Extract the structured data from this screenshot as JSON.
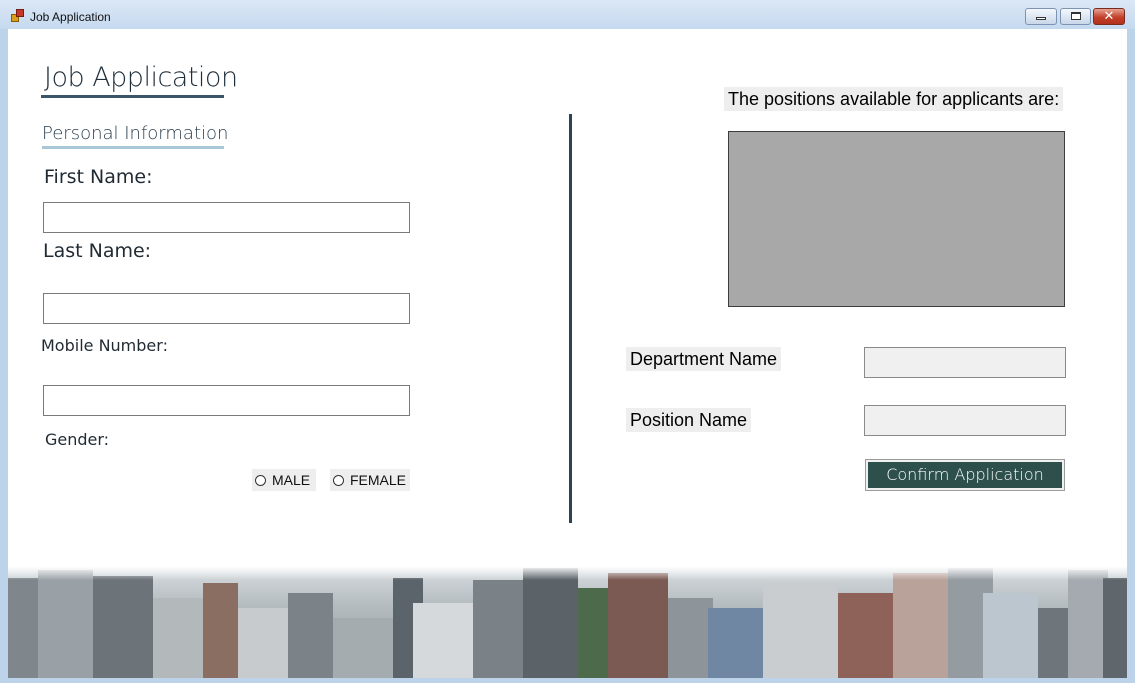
{
  "window": {
    "title": "Job Application",
    "controls": {
      "minimize": "minimize-icon",
      "maximize": "maximize-icon",
      "close": "close-icon"
    }
  },
  "form": {
    "heading": "Job Application",
    "section_title": "Personal Information",
    "first_name_label": "First Name:",
    "first_name_value": "",
    "last_name_label": "Last Name:",
    "last_name_value": "",
    "mobile_label": "Mobile Number:",
    "mobile_value": "",
    "gender_label": "Gender:",
    "gender_options": [
      "MALE",
      "FEMALE"
    ]
  },
  "positions": {
    "caption": "The positions available for applicants are:",
    "department_label": "Department Name",
    "department_value": "",
    "position_label": "Position Name",
    "position_value": "",
    "confirm_label": "Confirm Application"
  },
  "colors": {
    "accent": "#2e504d",
    "divider": "#2c4354",
    "listbox": "#a8a8a8"
  }
}
